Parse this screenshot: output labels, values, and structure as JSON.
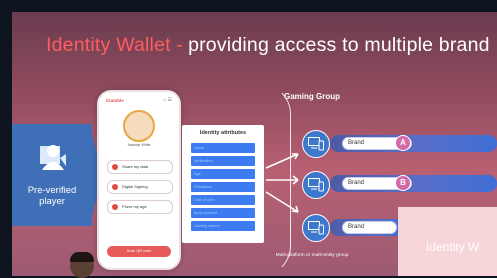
{
  "title": {
    "brand_part": "Identity Wallet -",
    "rest_part": "providing access to multiple brand"
  },
  "player": {
    "label": "Pre-verified player",
    "icon": "user-card-icon"
  },
  "phone": {
    "brand": "iGamble",
    "icons": "⌂ ☰",
    "user_name": "Jassmyr White",
    "buttons": [
      "Share my data",
      "Digital Signing",
      "Prove my age"
    ],
    "cta": "Scan QR code"
  },
  "attributes": {
    "title": "Identity attributes",
    "items": [
      "Name",
      "Verification",
      "Age",
      "Residence",
      "Date of birth",
      "Bank account",
      "Gaming history"
    ]
  },
  "group_label": "Gaming Group",
  "bottom_label": "Multi-platform or multi-entity group",
  "brands": [
    {
      "label": "Brand",
      "letter": "A"
    },
    {
      "label": "Brand",
      "letter": "B"
    },
    {
      "label": "Brand",
      "letter": ""
    }
  ],
  "overlay": {
    "text": "Identity W"
  },
  "colors": {
    "accent_red": "#ff5e5e",
    "panel_blue": "#3f6fb7",
    "attribute_blue": "#3c7cf0",
    "brand_badge": "#d46aa6"
  }
}
